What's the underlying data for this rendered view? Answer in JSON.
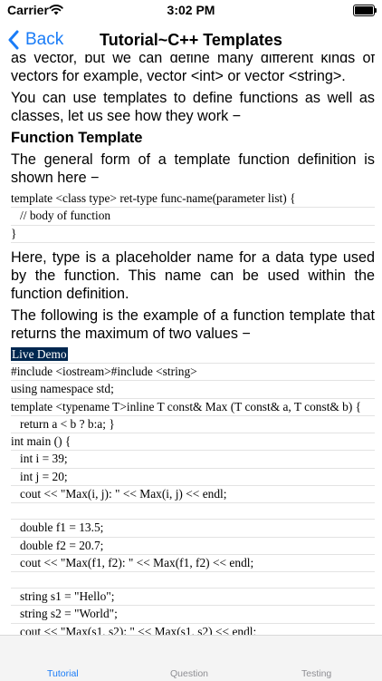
{
  "status": {
    "carrier": "Carrier",
    "time": "3:02 PM"
  },
  "nav": {
    "back_label": "Back",
    "title": "Tutorial~C++ Templates"
  },
  "content": {
    "p1": "as vector, but we can define many different kinds of vectors for example, vector <int> or vector <string>.",
    "p2": "You can use templates to define functions as well as classes, let us see how they work −",
    "h_function_template": "Function Template",
    "p3": "The general form of a template function definition is shown here −",
    "code1": [
      "template <class type> ret-type func-name(parameter list) {",
      "   // body of function",
      "}"
    ],
    "p4": "Here, type is a placeholder name for a data type used by the function. This name can be used within the function definition.",
    "p5": "The following is the example of a function template that returns the maximum of two values −",
    "live_demo": "Live Demo",
    "code2": [
      "#include <iostream>#include <string>",
      "using namespace std;",
      "template <typename T>inline T const& Max (T const& a, T const& b) {",
      "   return a < b ? b:a; }",
      "int main () {",
      "   int i = 39;",
      "   int j = 20;",
      "   cout << \"Max(i, j): \" << Max(i, j) << endl;",
      "",
      "   double f1 = 13.5;",
      "   double f2 = 20.7;",
      "   cout << \"Max(f1, f2): \" << Max(f1, f2) << endl;",
      "",
      "   string s1 = \"Hello\";",
      "   string s2 = \"World\";",
      "   cout << \"Max(s1, s2): \" << Max(s1, s2) << endl;"
    ]
  },
  "tabs": [
    {
      "label": "Tutorial",
      "active": true
    },
    {
      "label": "Question",
      "active": false
    },
    {
      "label": "Testing",
      "active": false
    }
  ],
  "colors": {
    "accent": "#1a7cf7",
    "live_demo_bg": "#00274f"
  }
}
